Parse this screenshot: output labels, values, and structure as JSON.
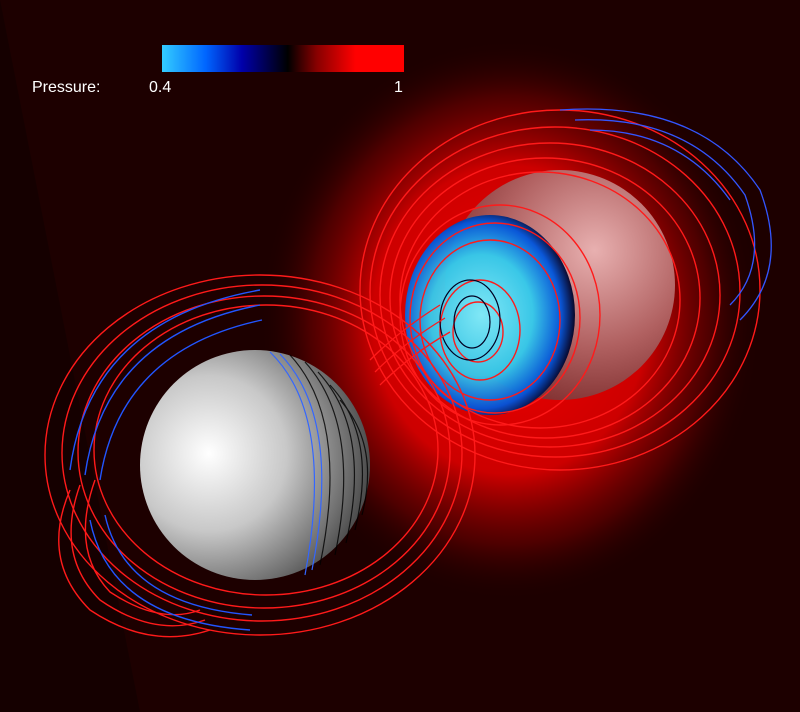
{
  "legend": {
    "title": "Pressure:",
    "min_label": "0.4",
    "max_label": "1",
    "colormap": [
      "#33ccff",
      "#0066ff",
      "#0000aa",
      "#000000",
      "#880000",
      "#ff0000"
    ]
  },
  "colors": {
    "background": "#1a0000",
    "glow": "#ff0000",
    "low_pressure": "#33ccff",
    "high_pressure": "#ff0000",
    "sphere": "#d8d8d8"
  }
}
